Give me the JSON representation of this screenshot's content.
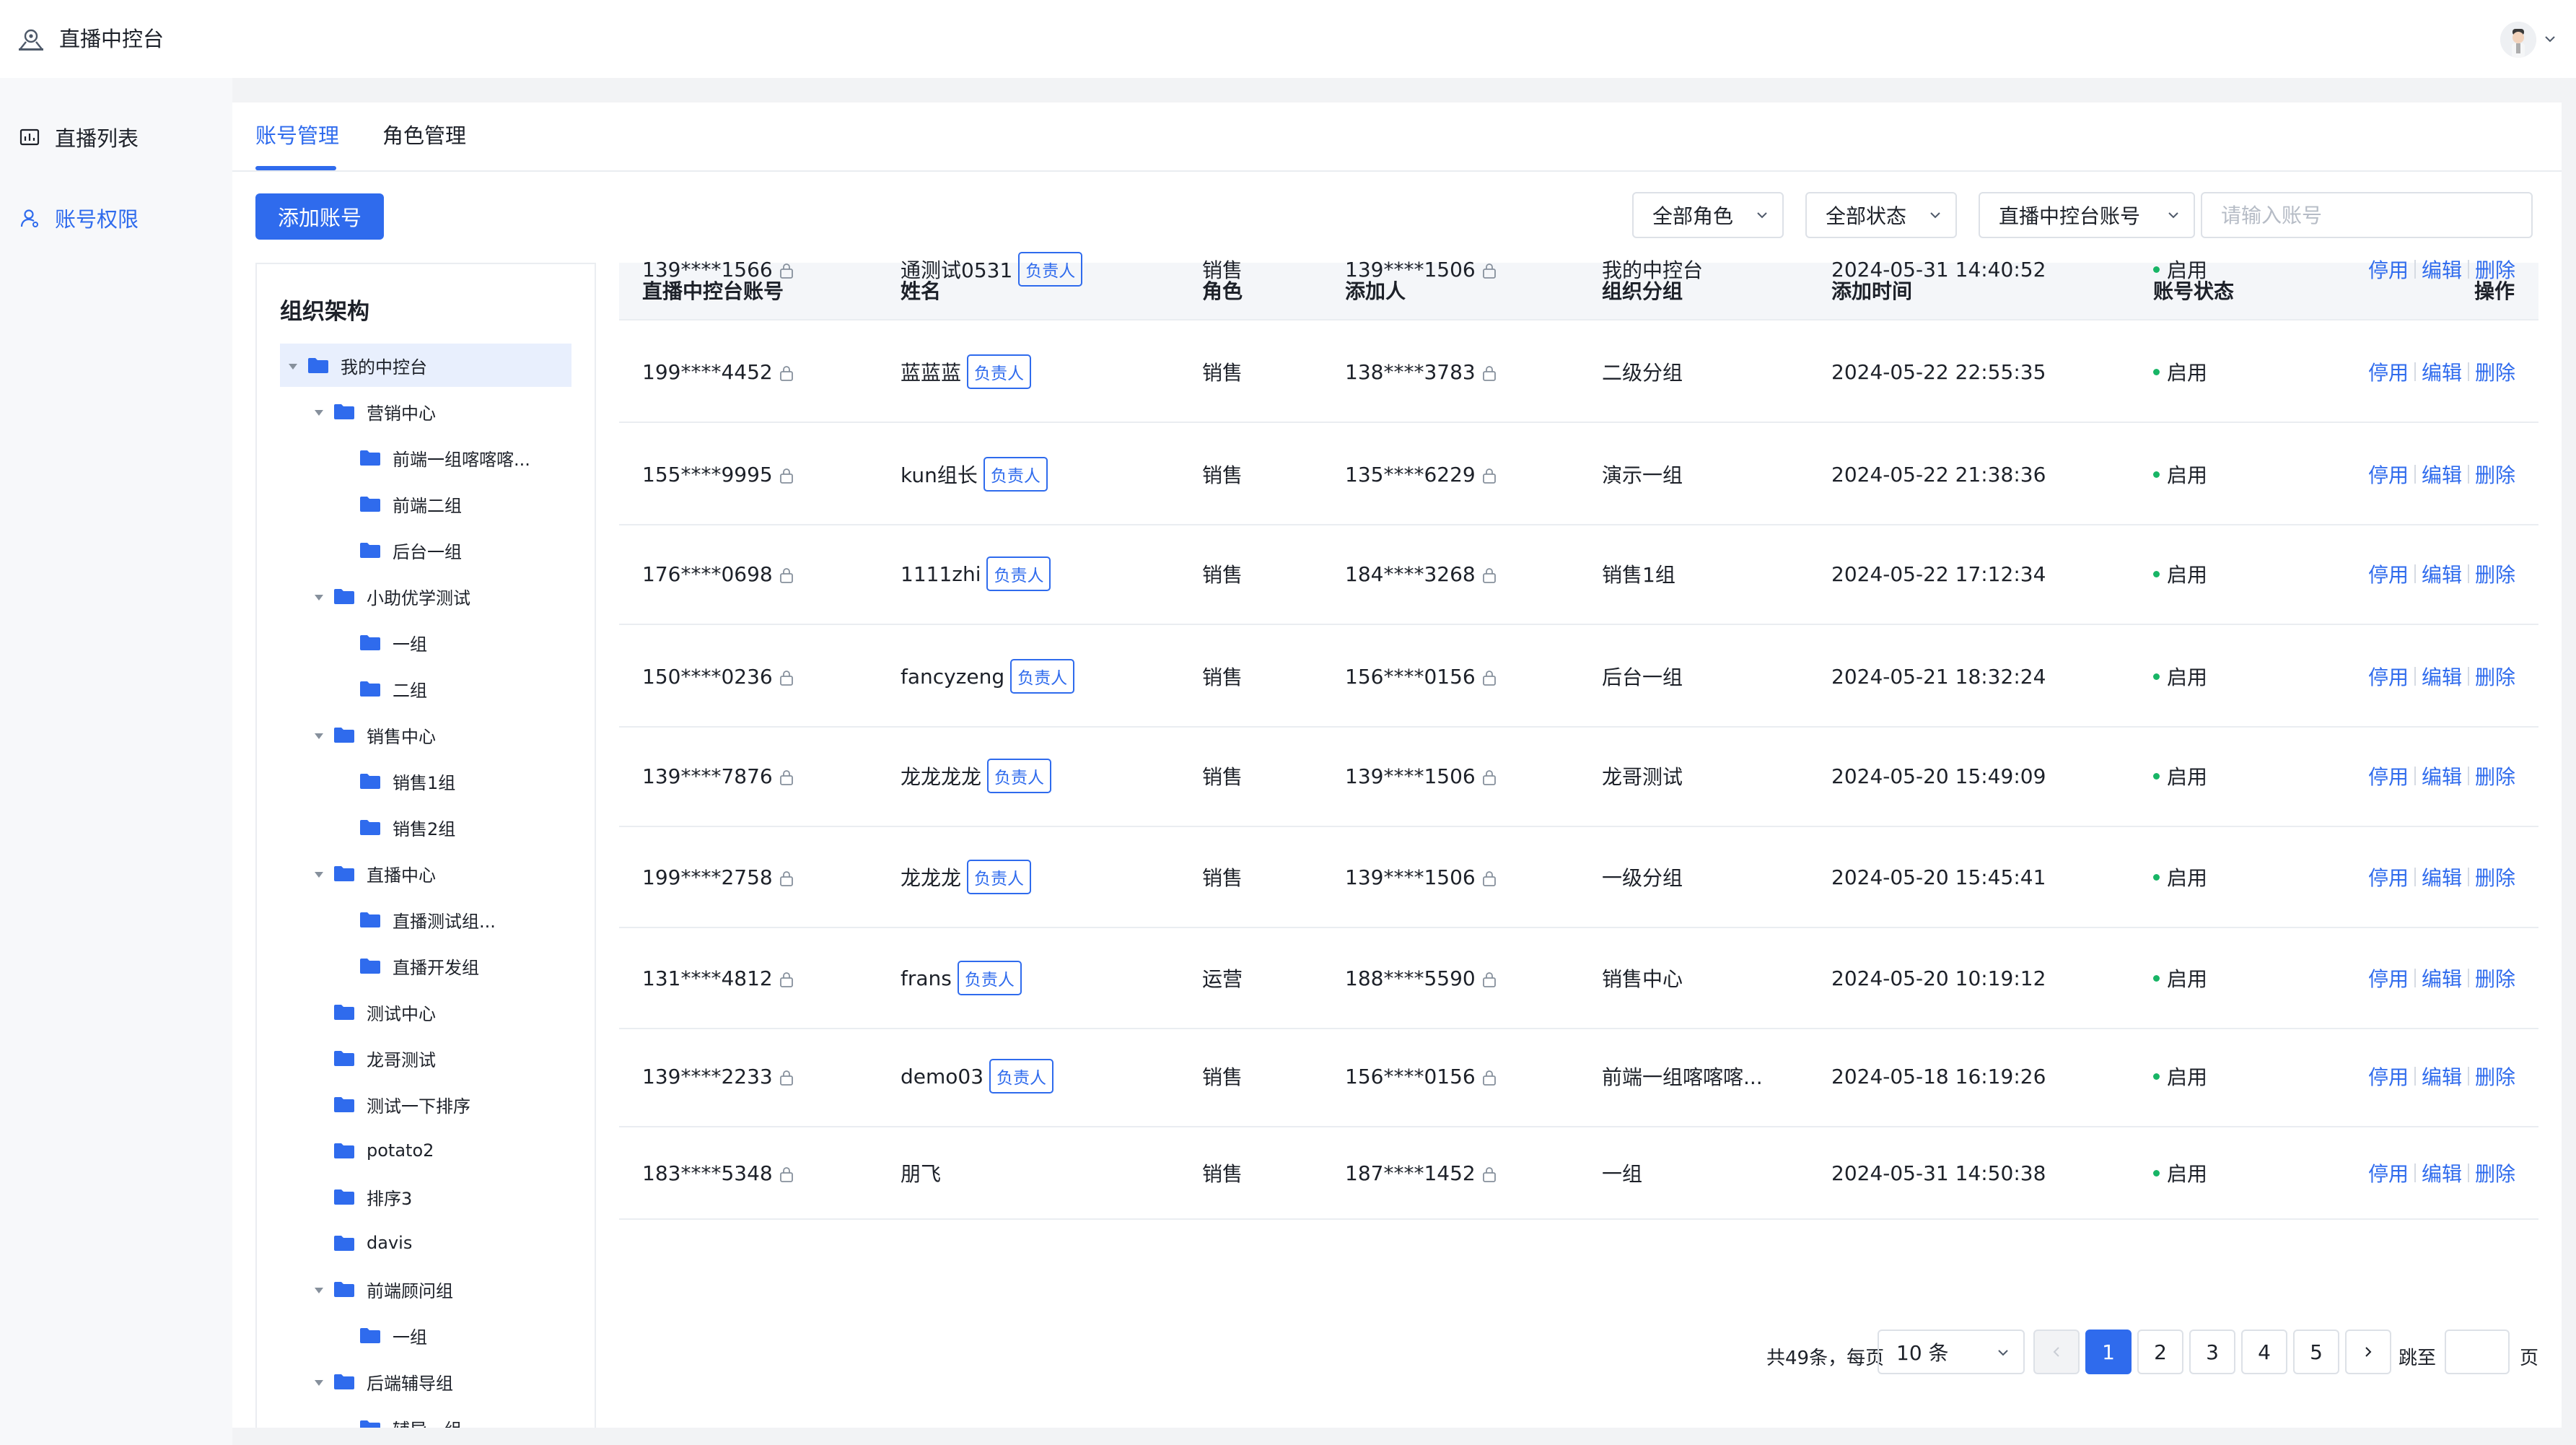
{
  "app": {
    "title": "直播中控台",
    "logo_icon": "live-console-logo-icon",
    "user_menu_icon": "chevron-down-icon"
  },
  "sidebar": {
    "items": [
      {
        "label": "直播列表",
        "icon": "live-list-icon",
        "active": false
      },
      {
        "label": "账号权限",
        "icon": "user-permission-icon",
        "active": true
      }
    ]
  },
  "tabs": [
    {
      "label": "账号管理",
      "active": true
    },
    {
      "label": "角色管理",
      "active": false
    }
  ],
  "toolbar": {
    "add_label": "添加账号",
    "role_filter": "全部角色",
    "status_filter": "全部状态",
    "account_type": "直播中控台账号",
    "search_placeholder": "请输入账号"
  },
  "tree": {
    "title": "组织架构",
    "nodes": [
      {
        "label": "我的中控台",
        "level": 0,
        "expanded": true,
        "selected": true
      },
      {
        "label": "营销中心",
        "level": 1,
        "expanded": true
      },
      {
        "label": "前端一组喀喀喀...",
        "level": 2
      },
      {
        "label": "前端二组",
        "level": 2
      },
      {
        "label": "后台一组",
        "level": 2
      },
      {
        "label": "小助优学测试",
        "level": 1,
        "expanded": true
      },
      {
        "label": "一组",
        "level": 2
      },
      {
        "label": "二组",
        "level": 2
      },
      {
        "label": "销售中心",
        "level": 1,
        "expanded": true
      },
      {
        "label": "销售1组",
        "level": 2
      },
      {
        "label": "销售2组",
        "level": 2
      },
      {
        "label": "直播中心",
        "level": 1,
        "expanded": true
      },
      {
        "label": "直播测试组...",
        "level": 2
      },
      {
        "label": "直播开发组",
        "level": 2
      },
      {
        "label": "测试中心",
        "level": 1
      },
      {
        "label": "龙哥测试",
        "level": 1
      },
      {
        "label": "测试一下排序",
        "level": 1
      },
      {
        "label": "potato2",
        "level": 1
      },
      {
        "label": "排序3",
        "level": 1
      },
      {
        "label": "davis",
        "level": 1
      },
      {
        "label": "前端顾问组",
        "level": 1,
        "expanded": true
      },
      {
        "label": "一组",
        "level": 2
      },
      {
        "label": "后端辅导组",
        "level": 1,
        "expanded": true
      },
      {
        "label": "辅导一组",
        "level": 2
      }
    ]
  },
  "table": {
    "columns": [
      "直播中控台账号",
      "姓名",
      "角色",
      "添加人",
      "组织分组",
      "添加时间",
      "账号状态",
      "操作"
    ],
    "tag_label": "负责人",
    "actions": [
      "停用",
      "编辑",
      "删除"
    ],
    "rows": [
      {
        "account": "139****1566",
        "name": "通测试0531",
        "leader": true,
        "role": "销售",
        "adder": "139****1506",
        "group": "我的中控台",
        "time": "2024-05-31 14:40:52",
        "status": "启用"
      },
      {
        "account": "199****4452",
        "name": "蓝蓝蓝",
        "leader": true,
        "role": "销售",
        "adder": "138****3783",
        "group": "二级分组",
        "time": "2024-05-22 22:55:35",
        "status": "启用"
      },
      {
        "account": "155****9995",
        "name": "kun组长",
        "leader": true,
        "role": "销售",
        "adder": "135****6229",
        "group": "演示一组",
        "time": "2024-05-22 21:38:36",
        "status": "启用"
      },
      {
        "account": "176****0698",
        "name": "1111zhi",
        "leader": true,
        "role": "销售",
        "adder": "184****3268",
        "group": "销售1组",
        "time": "2024-05-22 17:12:34",
        "status": "启用"
      },
      {
        "account": "150****0236",
        "name": "fancyzeng",
        "leader": true,
        "role": "销售",
        "adder": "156****0156",
        "group": "后台一组",
        "time": "2024-05-21 18:32:24",
        "status": "启用"
      },
      {
        "account": "139****7876",
        "name": "龙龙龙龙",
        "leader": true,
        "role": "销售",
        "adder": "139****1506",
        "group": "龙哥测试",
        "time": "2024-05-20 15:49:09",
        "status": "启用"
      },
      {
        "account": "199****2758",
        "name": "龙龙龙",
        "leader": true,
        "role": "销售",
        "adder": "139****1506",
        "group": "一级分组",
        "time": "2024-05-20 15:45:41",
        "status": "启用"
      },
      {
        "account": "131****4812",
        "name": "frans",
        "leader": true,
        "role": "运营",
        "adder": "188****5590",
        "group": "销售中心",
        "time": "2024-05-20 10:19:12",
        "status": "启用"
      },
      {
        "account": "139****2233",
        "name": "demo03",
        "leader": true,
        "role": "销售",
        "adder": "156****0156",
        "group": "前端一组喀喀喀...",
        "time": "2024-05-18 16:19:26",
        "status": "启用"
      },
      {
        "account": "183****5348",
        "name": "朋飞",
        "leader": false,
        "role": "销售",
        "adder": "187****1452",
        "group": "一组",
        "time": "2024-05-31 14:50:38",
        "status": "启用"
      }
    ]
  },
  "pagination": {
    "total_text": "共49条，每页",
    "page_size": "10 条",
    "pages": [
      "1",
      "2",
      "3",
      "4",
      "5"
    ],
    "current": "1",
    "jump_label": "跳至",
    "page_unit": "页"
  },
  "colors": {
    "primary": "#2f6bed",
    "status_enabled": "#18b566",
    "border": "#dde1e7"
  }
}
